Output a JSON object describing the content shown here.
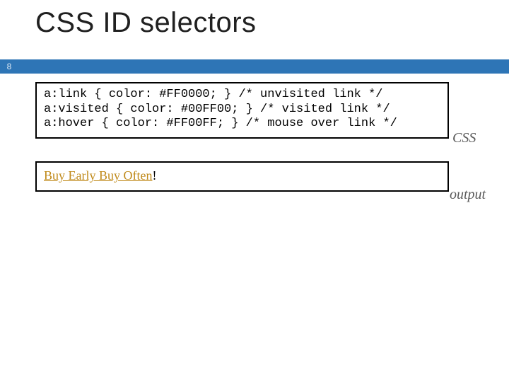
{
  "slide": {
    "title": "CSS ID selectors",
    "page_number": "8"
  },
  "code": {
    "line1": "a:link { color: #FF0000; } /* unvisited link */",
    "line2": "a:visited { color: #00FF00; } /* visited link */",
    "line3": "a:hover { color: #FF00FF; } /* mouse over link */",
    "label": "CSS"
  },
  "output": {
    "link_text": "Buy Early Buy Often",
    "suffix": "!",
    "label": "output"
  }
}
